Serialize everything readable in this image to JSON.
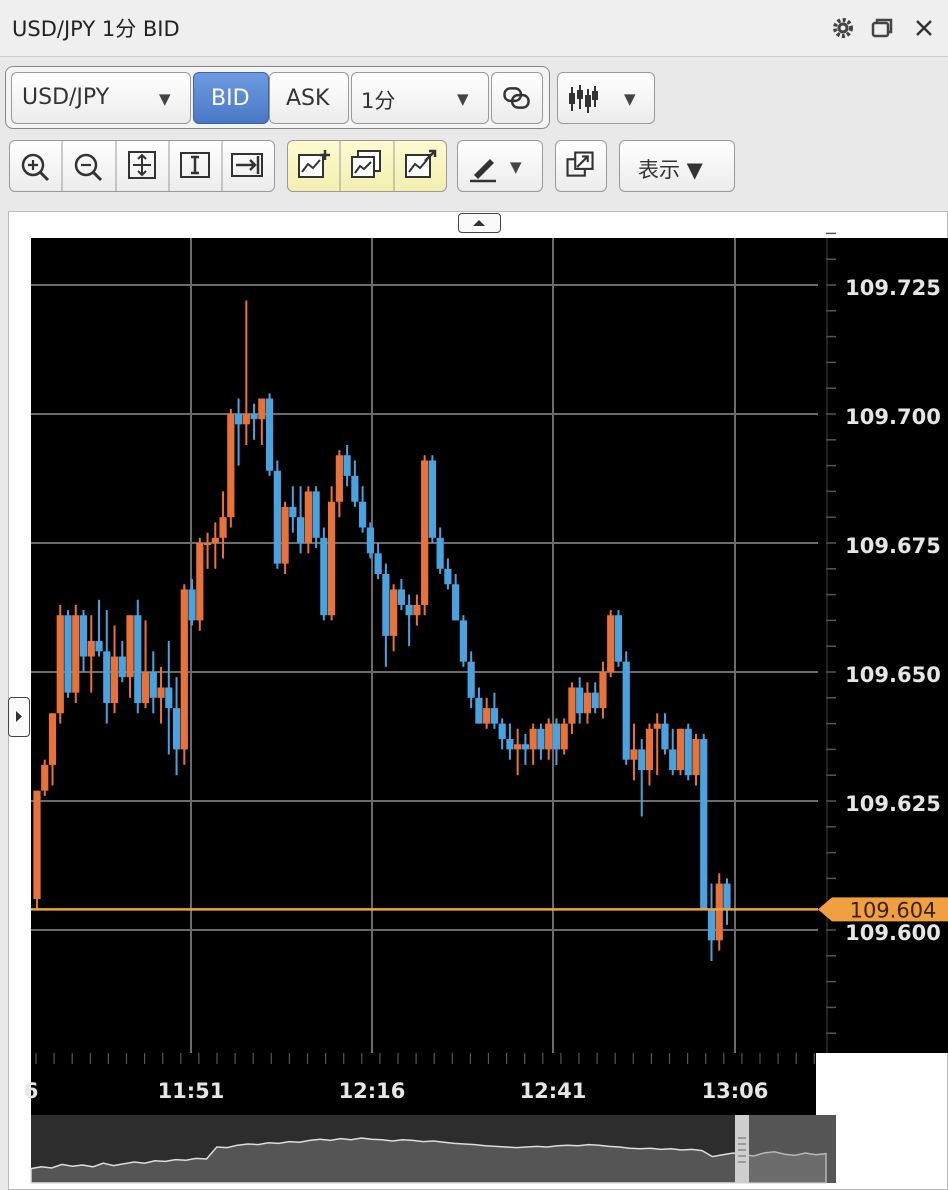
{
  "window": {
    "title": "USD/JPY 1分 BID"
  },
  "toolbar": {
    "symbol": "USD/JPY",
    "bid_label": "BID",
    "ask_label": "ASK",
    "interval": "1分",
    "display_label": "表示 ▼",
    "icons": [
      "gear-icon",
      "restore-icon",
      "close-icon",
      "link-icon",
      "candlestick-icon",
      "zoom-in-icon",
      "zoom-out-icon",
      "fit-icon",
      "range-icon",
      "scroll-end-icon",
      "add-indicator-icon",
      "compare-icon",
      "trend-icon",
      "pen-icon",
      "popout-icon"
    ]
  },
  "chart_data": {
    "type": "candlestick",
    "y_ticks": [
      "109.725",
      "109.700",
      "109.675",
      "109.650",
      "109.625",
      "109.600"
    ],
    "x_ticks": [
      "6",
      "11:51",
      "12:16",
      "12:41",
      "13:06"
    ],
    "current_price": "109.604",
    "ylim": [
      109.578,
      109.737
    ],
    "colors": {
      "up": "#e8733a",
      "down": "#4aa3df",
      "current": "#f0a040"
    },
    "candles": [
      [
        109.606,
        109.627,
        109.604,
        109.627
      ],
      [
        109.627,
        109.633,
        109.626,
        109.632
      ],
      [
        109.632,
        109.642,
        109.628,
        109.642
      ],
      [
        109.642,
        109.663,
        109.64,
        109.661
      ],
      [
        109.661,
        109.662,
        109.645,
        109.646
      ],
      [
        109.646,
        109.663,
        109.644,
        109.661
      ],
      [
        109.661,
        109.662,
        109.65,
        109.653
      ],
      [
        109.653,
        109.661,
        109.646,
        109.656
      ],
      [
        109.656,
        109.664,
        109.653,
        109.654
      ],
      [
        109.654,
        109.662,
        109.64,
        109.644
      ],
      [
        109.644,
        109.659,
        109.642,
        109.653
      ],
      [
        109.653,
        109.656,
        109.648,
        109.649
      ],
      [
        109.649,
        109.661,
        109.645,
        109.661
      ],
      [
        109.661,
        109.664,
        109.642,
        109.644
      ],
      [
        109.644,
        109.66,
        109.643,
        109.65
      ],
      [
        109.65,
        109.654,
        109.642,
        109.645
      ],
      [
        109.645,
        109.651,
        109.64,
        109.647
      ],
      [
        109.647,
        109.656,
        109.634,
        109.643
      ],
      [
        109.643,
        109.649,
        109.63,
        109.635
      ],
      [
        109.635,
        109.667,
        109.632,
        109.666
      ],
      [
        109.666,
        109.668,
        109.659,
        109.66
      ],
      [
        109.66,
        109.676,
        109.658,
        109.675
      ],
      [
        109.675,
        109.677,
        109.67,
        109.675
      ],
      [
        109.675,
        109.679,
        109.67,
        109.676
      ],
      [
        109.676,
        109.685,
        109.672,
        109.68
      ],
      [
        109.68,
        109.701,
        109.678,
        109.7
      ],
      [
        109.7,
        109.703,
        109.69,
        109.698
      ],
      [
        109.698,
        109.722,
        109.694,
        109.7
      ],
      [
        109.7,
        109.702,
        109.695,
        109.699
      ],
      [
        109.699,
        109.702,
        109.694,
        109.703
      ],
      [
        109.703,
        109.704,
        109.688,
        109.689
      ],
      [
        109.689,
        109.691,
        109.67,
        109.671
      ],
      [
        109.671,
        109.683,
        109.669,
        109.682
      ],
      [
        109.682,
        109.686,
        109.677,
        109.68
      ],
      [
        109.68,
        109.686,
        109.673,
        109.675
      ],
      [
        109.675,
        109.686,
        109.673,
        109.685
      ],
      [
        109.685,
        109.686,
        109.674,
        109.676
      ],
      [
        109.676,
        109.678,
        109.66,
        109.661
      ],
      [
        109.661,
        109.686,
        109.66,
        109.683
      ],
      [
        109.683,
        109.693,
        109.68,
        109.692
      ],
      [
        109.692,
        109.694,
        109.686,
        109.688
      ],
      [
        109.688,
        109.691,
        109.682,
        109.683
      ],
      [
        109.683,
        109.686,
        109.677,
        109.678
      ],
      [
        109.678,
        109.679,
        109.672,
        109.673
      ],
      [
        109.673,
        109.675,
        109.668,
        109.669
      ],
      [
        109.669,
        109.671,
        109.651,
        109.657
      ],
      [
        109.657,
        109.667,
        109.654,
        109.666
      ],
      [
        109.666,
        109.668,
        109.662,
        109.663
      ],
      [
        109.663,
        109.665,
        109.655,
        109.661
      ],
      [
        109.661,
        109.665,
        109.659,
        109.663
      ],
      [
        109.663,
        109.692,
        109.661,
        109.691
      ],
      [
        109.691,
        109.692,
        109.675,
        109.676
      ],
      [
        109.676,
        109.678,
        109.669,
        109.67
      ],
      [
        109.67,
        109.672,
        109.666,
        109.667
      ],
      [
        109.667,
        109.669,
        109.66,
        109.66
      ],
      [
        109.66,
        109.661,
        109.651,
        109.652
      ],
      [
        109.652,
        109.654,
        109.643,
        109.645
      ],
      [
        109.645,
        109.647,
        109.64,
        109.64
      ],
      [
        109.64,
        109.645,
        109.639,
        109.643
      ],
      [
        109.643,
        109.646,
        109.639,
        109.64
      ],
      [
        109.64,
        109.641,
        109.635,
        109.637
      ],
      [
        109.637,
        109.64,
        109.633,
        109.635
      ],
      [
        109.635,
        109.639,
        109.63,
        109.636
      ],
      [
        109.636,
        109.638,
        109.632,
        109.635
      ],
      [
        109.635,
        109.64,
        109.632,
        109.639
      ],
      [
        109.639,
        109.64,
        109.633,
        109.635
      ],
      [
        109.635,
        109.641,
        109.633,
        109.64
      ],
      [
        109.64,
        109.641,
        109.632,
        109.635
      ],
      [
        109.635,
        109.641,
        109.634,
        109.64
      ],
      [
        109.64,
        109.648,
        109.638,
        109.647
      ],
      [
        109.647,
        109.649,
        109.64,
        109.642
      ],
      [
        109.642,
        109.648,
        109.64,
        109.646
      ],
      [
        109.646,
        109.648,
        109.642,
        109.643
      ],
      [
        109.643,
        109.652,
        109.641,
        109.65
      ],
      [
        109.65,
        109.662,
        109.649,
        109.661
      ],
      [
        109.661,
        109.662,
        109.651,
        109.652
      ],
      [
        109.652,
        109.654,
        109.632,
        109.633
      ],
      [
        109.633,
        109.64,
        109.629,
        109.635
      ],
      [
        109.635,
        109.637,
        109.622,
        109.631
      ],
      [
        109.631,
        109.64,
        109.628,
        109.639
      ],
      [
        109.639,
        109.642,
        109.63,
        109.64
      ],
      [
        109.64,
        109.642,
        109.634,
        109.635
      ],
      [
        109.635,
        109.639,
        109.63,
        109.631
      ],
      [
        109.631,
        109.639,
        109.63,
        109.639
      ],
      [
        109.639,
        109.64,
        109.629,
        109.63
      ],
      [
        109.63,
        109.638,
        109.628,
        109.637
      ],
      [
        109.637,
        109.638,
        109.604,
        109.604
      ],
      [
        109.604,
        109.609,
        109.594,
        109.598
      ],
      [
        109.598,
        109.611,
        109.596,
        109.609
      ],
      [
        109.609,
        109.61,
        109.601,
        109.604
      ]
    ],
    "overview_values": [
      0.24,
      0.27,
      0.25,
      0.31,
      0.28,
      0.3,
      0.27,
      0.33,
      0.29,
      0.32,
      0.35,
      0.33,
      0.37,
      0.36,
      0.39,
      0.38,
      0.41,
      0.4,
      0.6,
      0.59,
      0.63,
      0.65,
      0.64,
      0.67,
      0.66,
      0.69,
      0.68,
      0.71,
      0.73,
      0.71,
      0.74,
      0.72,
      0.75,
      0.73,
      0.72,
      0.7,
      0.72,
      0.71,
      0.69,
      0.7,
      0.68,
      0.66,
      0.65,
      0.64,
      0.62,
      0.61,
      0.6,
      0.59,
      0.6,
      0.61,
      0.6,
      0.62,
      0.63,
      0.62,
      0.64,
      0.63,
      0.61,
      0.6,
      0.58,
      0.57,
      0.58,
      0.56,
      0.57,
      0.55,
      0.56,
      0.54,
      0.44,
      0.47,
      0.5,
      0.47,
      0.45,
      0.5,
      0.52,
      0.48,
      0.46,
      0.5,
      0.47,
      0.49
    ]
  }
}
